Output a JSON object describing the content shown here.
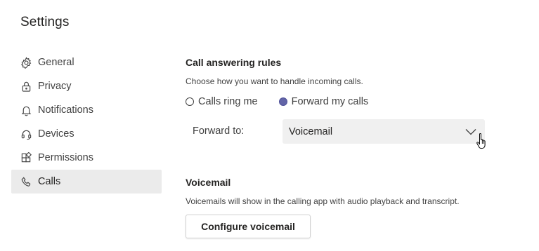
{
  "page": {
    "title": "Settings"
  },
  "sidebar": {
    "items": [
      {
        "label": "General",
        "icon": "gear-icon"
      },
      {
        "label": "Privacy",
        "icon": "lock-icon"
      },
      {
        "label": "Notifications",
        "icon": "bell-icon"
      },
      {
        "label": "Devices",
        "icon": "headset-icon"
      },
      {
        "label": "Permissions",
        "icon": "apps-icon"
      },
      {
        "label": "Calls",
        "icon": "phone-icon",
        "active": true
      }
    ]
  },
  "call_answering": {
    "title": "Call answering rules",
    "description": "Choose how you want to handle incoming calls.",
    "options": [
      {
        "label": "Calls ring me",
        "selected": false
      },
      {
        "label": "Forward my calls",
        "selected": true
      }
    ],
    "forward_label": "Forward to:",
    "forward_value": "Voicemail"
  },
  "voicemail": {
    "title": "Voicemail",
    "description": "Voicemails will show in the calling app with audio playback and transcript.",
    "button_label": "Configure voicemail"
  },
  "colors": {
    "accent": "#6264a7",
    "active_nav_bg": "#ebebeb",
    "select_bg": "#f0f0f0"
  }
}
